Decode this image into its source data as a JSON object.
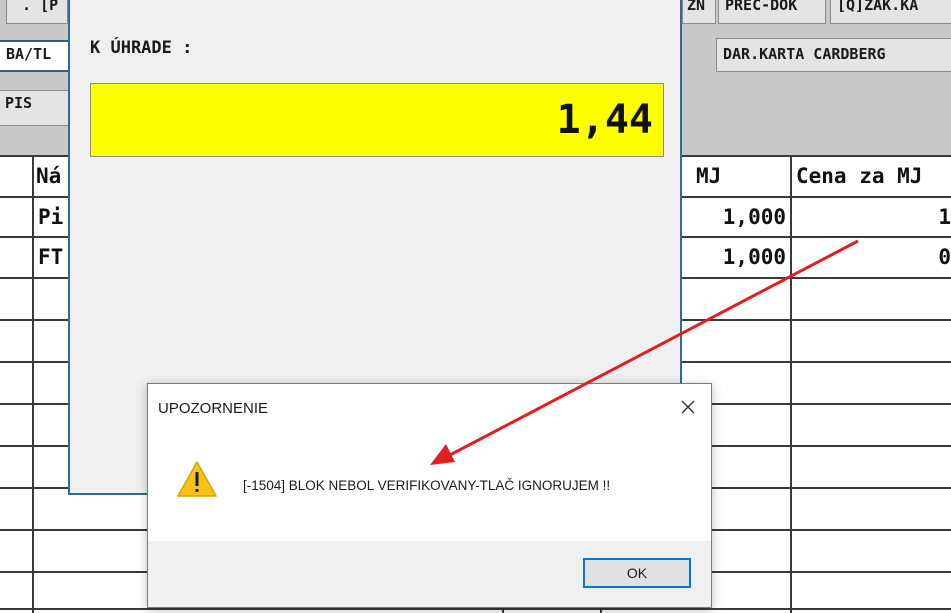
{
  "toolbar": {
    "top_left_1": "˙. [P",
    "top_left_2": "BA/TL",
    "top_left_3": "PIS",
    "top_right_1": "ZN",
    "top_right_2": "PREC-DOK",
    "top_right_3": "[Q]ZAK.KA",
    "top_right_4": "DAR.KARTA CARDBERG"
  },
  "table": {
    "headers": {
      "name": "Ná",
      "unit": "MJ",
      "price": "Cena za MJ"
    },
    "rows": [
      {
        "name": "Pi",
        "unit": "1,000",
        "price": "1"
      },
      {
        "name": "FT",
        "unit": "1,000",
        "price": "0"
      }
    ]
  },
  "payment": {
    "label": "K ÚHRADE :",
    "amount": "1,44",
    "amount_bg": "#ffff00"
  },
  "dialog": {
    "title": "UPOZORNENIE",
    "message": "[-1504] BLOK NEBOL VERIFIKOVANY-TLAČ IGNORUJEM  !!",
    "ok_label": "OK",
    "icon": "warning-icon",
    "close_icon": "close-icon"
  },
  "annotation": {
    "arrow_color": "#e02020"
  }
}
